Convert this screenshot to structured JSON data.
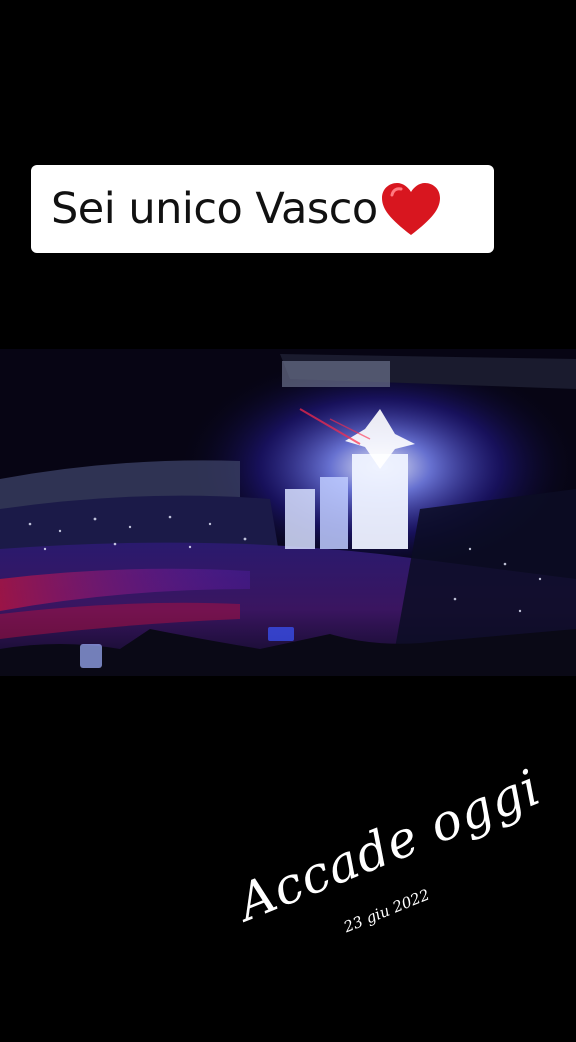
{
  "caption": {
    "text": "Sei unico Vasco",
    "emoji": "heart-emoji-icon",
    "heart_color": "#d8161f"
  },
  "video": {
    "scene": "concert-stadium-photo"
  },
  "overlay": {
    "title": "Accade oggi",
    "date": "23 giu 2022"
  },
  "colors": {
    "background": "#000000",
    "caption_bg": "#ffffff",
    "stage_light": "#dfe6ff"
  }
}
